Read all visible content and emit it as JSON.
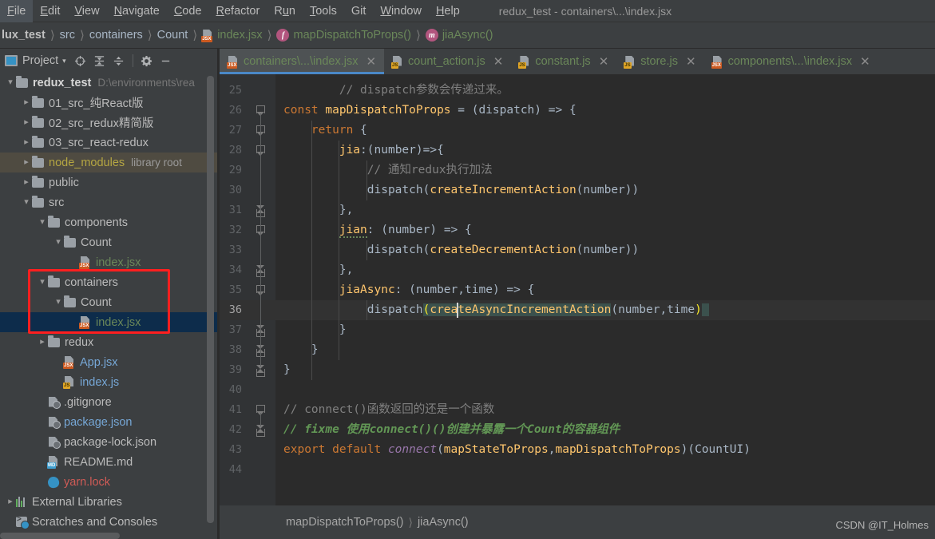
{
  "menubar": {
    "items": [
      {
        "label": "File",
        "mnemonic": "F"
      },
      {
        "label": "Edit",
        "mnemonic": "E"
      },
      {
        "label": "View",
        "mnemonic": "V"
      },
      {
        "label": "Navigate",
        "mnemonic": "N"
      },
      {
        "label": "Code",
        "mnemonic": "C"
      },
      {
        "label": "Refactor",
        "mnemonic": "R"
      },
      {
        "label": "Run",
        "mnemonic": "u"
      },
      {
        "label": "Tools",
        "mnemonic": "T"
      },
      {
        "label": "Git",
        "mnemonic": ""
      },
      {
        "label": "Window",
        "mnemonic": "W"
      },
      {
        "label": "Help",
        "mnemonic": "H"
      }
    ],
    "window_title": "redux_test - containers\\...\\index.jsx"
  },
  "breadcrumb": {
    "items": [
      {
        "label": "lux_test",
        "kind": "project",
        "color": "bold"
      },
      {
        "label": "src",
        "kind": "dir",
        "color": "plain"
      },
      {
        "label": "containers",
        "kind": "dir",
        "color": "plain"
      },
      {
        "label": "Count",
        "kind": "dir",
        "color": "plain"
      },
      {
        "label": "index.jsx",
        "kind": "jsx-file",
        "color": "green"
      },
      {
        "label": "mapDispatchToProps()",
        "kind": "function",
        "color": "green"
      },
      {
        "label": "jiaAsync()",
        "kind": "method",
        "color": "green"
      }
    ],
    "separator": "›"
  },
  "toolwindow": {
    "title": "Project",
    "caret": "▾",
    "buttons": [
      {
        "name": "select-opened-file-icon",
        "glyph": "⊕"
      },
      {
        "name": "expand-all-icon",
        "glyph": "↧"
      },
      {
        "name": "collapse-all-icon",
        "glyph": "↥"
      },
      {
        "name": "settings-gear-icon",
        "glyph": "⚙"
      },
      {
        "name": "hide-icon",
        "glyph": "—"
      }
    ]
  },
  "tree": {
    "rows": [
      {
        "indent": 0,
        "arrow": "down",
        "icon": "folder",
        "label": "redux_test",
        "style": "bold",
        "hint": "D:\\environments\\rea",
        "row_style": "normal"
      },
      {
        "indent": 1,
        "arrow": "right",
        "icon": "folder",
        "label": "01_src_纯React版",
        "style": "plain",
        "hint": "",
        "row_style": "normal"
      },
      {
        "indent": 1,
        "arrow": "right",
        "icon": "folder",
        "label": "02_src_redux精简版",
        "style": "plain",
        "hint": "",
        "row_style": "normal"
      },
      {
        "indent": 1,
        "arrow": "right",
        "icon": "folder",
        "label": "03_src_react-redux",
        "style": "plain",
        "hint": "",
        "row_style": "normal"
      },
      {
        "indent": 1,
        "arrow": "right",
        "icon": "folder",
        "label": "node_modules",
        "style": "yellow",
        "hint": "library root",
        "row_style": "lib"
      },
      {
        "indent": 1,
        "arrow": "right",
        "icon": "folder",
        "label": "public",
        "style": "plain",
        "hint": "",
        "row_style": "normal"
      },
      {
        "indent": 1,
        "arrow": "down",
        "icon": "folder",
        "label": "src",
        "style": "plain",
        "hint": "",
        "row_style": "normal"
      },
      {
        "indent": 2,
        "arrow": "down",
        "icon": "folder",
        "label": "components",
        "style": "plain",
        "hint": "",
        "row_style": "normal"
      },
      {
        "indent": 3,
        "arrow": "down",
        "icon": "folder",
        "label": "Count",
        "style": "plain",
        "hint": "",
        "row_style": "normal"
      },
      {
        "indent": 4,
        "arrow": "none",
        "icon": "jsx",
        "label": "index.jsx",
        "style": "green",
        "hint": "",
        "row_style": "normal"
      },
      {
        "indent": 2,
        "arrow": "down",
        "icon": "folder",
        "label": "containers",
        "style": "plain",
        "hint": "",
        "row_style": "normal"
      },
      {
        "indent": 3,
        "arrow": "down",
        "icon": "folder",
        "label": "Count",
        "style": "plain",
        "hint": "",
        "row_style": "normal"
      },
      {
        "indent": 4,
        "arrow": "none",
        "icon": "jsx",
        "label": "index.jsx",
        "style": "green",
        "hint": "",
        "row_style": "selected"
      },
      {
        "indent": 2,
        "arrow": "right",
        "icon": "folder",
        "label": "redux",
        "style": "plain",
        "hint": "",
        "row_style": "normal"
      },
      {
        "indent": 3,
        "arrow": "none",
        "icon": "jsx",
        "label": "App.jsx",
        "style": "blue",
        "hint": "",
        "row_style": "normal"
      },
      {
        "indent": 3,
        "arrow": "none",
        "icon": "js",
        "label": "index.js",
        "style": "blue",
        "hint": "",
        "row_style": "normal"
      },
      {
        "indent": 2,
        "arrow": "none",
        "icon": "gear",
        "label": ".gitignore",
        "style": "plain",
        "hint": "",
        "row_style": "normal"
      },
      {
        "indent": 2,
        "arrow": "none",
        "icon": "gear",
        "label": "package.json",
        "style": "blue",
        "hint": "",
        "row_style": "normal"
      },
      {
        "indent": 2,
        "arrow": "none",
        "icon": "gear",
        "label": "package-lock.json",
        "style": "plain",
        "hint": "",
        "row_style": "normal"
      },
      {
        "indent": 2,
        "arrow": "none",
        "icon": "md",
        "label": "README.md",
        "style": "plain",
        "hint": "",
        "row_style": "normal"
      },
      {
        "indent": 2,
        "arrow": "none",
        "icon": "yarn",
        "label": "yarn.lock",
        "style": "red",
        "hint": "",
        "row_style": "normal"
      },
      {
        "indent": 0,
        "arrow": "right",
        "icon": "lib",
        "label": "External Libraries",
        "style": "plain",
        "hint": "",
        "row_style": "normal"
      },
      {
        "indent": 0,
        "arrow": "none",
        "icon": "scratch",
        "label": "Scratches and Consoles",
        "style": "plain",
        "hint": "",
        "row_style": "normal"
      }
    ]
  },
  "tabs": [
    {
      "label": "containers\\...\\index.jsx",
      "icon": "jsx",
      "active": true
    },
    {
      "label": "count_action.js",
      "icon": "js",
      "active": false
    },
    {
      "label": "constant.js",
      "icon": "js",
      "active": false
    },
    {
      "label": "store.js",
      "icon": "js",
      "active": false
    },
    {
      "label": "components\\...\\index.jsx",
      "icon": "jsx",
      "active": false
    }
  ],
  "editor": {
    "first_line": 25,
    "last_line": 44,
    "current_line": 36,
    "line_numbers": [
      25,
      26,
      27,
      28,
      29,
      30,
      31,
      32,
      33,
      34,
      35,
      36,
      37,
      38,
      39,
      40,
      41,
      42,
      43,
      44
    ],
    "lines": [
      {
        "n": 25,
        "text": "    // dispatch参数会传递过来。"
      },
      {
        "n": 26,
        "text": "  const mapDispatchToProps = (dispatch) => {"
      },
      {
        "n": 27,
        "text": "      return {"
      },
      {
        "n": 28,
        "text": "          jia:(number)=>{"
      },
      {
        "n": 29,
        "text": "              // 通知redux执行加法"
      },
      {
        "n": 30,
        "text": "              dispatch(createIncrementAction(number))"
      },
      {
        "n": 31,
        "text": "          },"
      },
      {
        "n": 32,
        "text": "          jian: (number) => {"
      },
      {
        "n": 33,
        "text": "              dispatch(createDecrementAction(number))"
      },
      {
        "n": 34,
        "text": "          },"
      },
      {
        "n": 35,
        "text": "          jiaAsync: (number,time) => {"
      },
      {
        "n": 36,
        "text": "              dispatch(createAsyncIncrementAction(number,time))"
      },
      {
        "n": 37,
        "text": "          }"
      },
      {
        "n": 38,
        "text": "      }"
      },
      {
        "n": 39,
        "text": "  }"
      },
      {
        "n": 40,
        "text": ""
      },
      {
        "n": 41,
        "text": "  // connect()函数返回的还是一个函数"
      },
      {
        "n": 42,
        "text": "  // fixme 使用connect()()创建并暴露一个Count的容器组件"
      },
      {
        "n": 43,
        "text": "  export default connect(mapStateToProps,mapDispatchToProps)(CountUI)"
      },
      {
        "n": 44,
        "text": ""
      }
    ]
  },
  "status_breadcrumb": {
    "items": [
      "mapDispatchToProps()",
      "jiaAsync()"
    ],
    "separator": "›"
  },
  "watermark": "CSDN @IT_Holmes",
  "colors": {
    "editor_bg": "#2b2b2b",
    "panel_bg": "#3c3f41",
    "gutter_bg": "#313335",
    "selection_blue": "#0d2c4b",
    "tab_active": "#4e5254",
    "tab_underline": "#4a88c7",
    "green_text": "#6a8759",
    "keyword_orange": "#cc7832",
    "function_yellow": "#ffc66d",
    "annotation_red": "#ff1f1f",
    "comment_gray": "#808080",
    "fixme_green": "#629755",
    "library_row": "#4f4b41"
  }
}
